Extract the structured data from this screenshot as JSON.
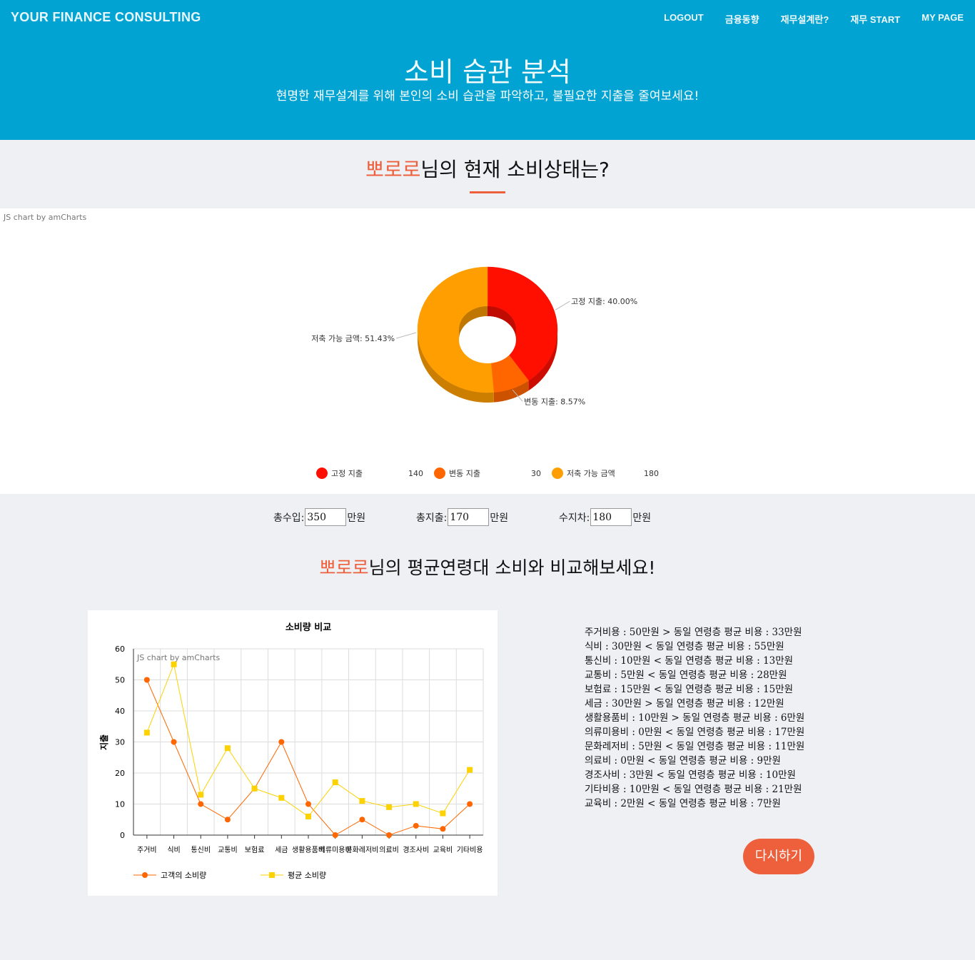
{
  "nav": {
    "brand": "YOUR FINANCE CONSULTING",
    "links": [
      "LOGOUT",
      "금융동향",
      "재무설계란?",
      "재무 START",
      "MY PAGE"
    ]
  },
  "hero": {
    "title": "소비 습관 분석",
    "subtitle": "현명한 재무설계를 위해 본인의 소비 습관을 파악하고, 불필요한 지출을 줄여보세요!"
  },
  "section1": {
    "user": "뽀로로",
    "title_rest": "님의 현재 소비상태는?"
  },
  "credit": "JS chart by amCharts",
  "colors": {
    "accent": "#ee5f3b",
    "header": "#00a3d1"
  },
  "chart_data": [
    {
      "type": "pie",
      "style": "3d-donut",
      "slices": [
        {
          "name": "고정 지출",
          "value": 140,
          "percent_label": "40.00%",
          "color": "#ff0f00"
        },
        {
          "name": "변동 지출",
          "value": 30,
          "percent_label": "8.57%",
          "color": "#ff6600"
        },
        {
          "name": "저축 가능 금액",
          "value": 180,
          "percent_label": "51.43%",
          "color": "#ff9e01"
        }
      ],
      "legend_position": "bottom"
    },
    {
      "type": "line",
      "title": "소비량 비교",
      "ylabel": "지출",
      "xlabel": "",
      "ylim": [
        0,
        60
      ],
      "yticks": [
        0,
        10,
        20,
        30,
        40,
        50,
        60
      ],
      "grid": true,
      "legend_position": "bottom",
      "categories": [
        "주거비",
        "식비",
        "통신비",
        "교통비",
        "보험료",
        "세금",
        "생활용품비",
        "의류미용비",
        "문화레저비",
        "의료비",
        "경조사비",
        "교육비",
        "기타비용"
      ],
      "series": [
        {
          "name": "고객의 소비량",
          "color": "#ff6600",
          "marker": "circle",
          "values": [
            50,
            30,
            10,
            5,
            15,
            30,
            10,
            0,
            5,
            0,
            3,
            2,
            10
          ]
        },
        {
          "name": "평균 소비량",
          "color": "#fcd202",
          "marker": "square",
          "values": [
            33,
            55,
            13,
            28,
            15,
            12,
            6,
            17,
            11,
            9,
            10,
            7,
            21
          ]
        }
      ]
    }
  ],
  "summary": {
    "income_label": "총수입:",
    "income_value": "350",
    "expense_label": "총지출:",
    "expense_value": "170",
    "balance_label": "수지차:",
    "balance_value": "180",
    "unit": "만원"
  },
  "section2": {
    "user": "뽀로로",
    "title_rest": "님의 평균연령대 소비와 비교해보세요!"
  },
  "compare_lines": [
    "주거비용 : 50만원 > 동일 연령층 평균 비용 : 33만원",
    "식비 : 30만원 < 동일 연령층 평균 비용 : 55만원",
    "통신비 : 10만원 < 동일 연령층 평균 비용 : 13만원",
    "교통비 : 5만원 < 동일 연령층 평균 비용 : 28만원",
    "보험료 : 15만원 < 동일 연령층 평균 비용 : 15만원",
    "세금 : 30만원 > 동일 연령층 평균 비용 : 12만원",
    "생활용품비 : 10만원 > 동일 연령층 평균 비용 : 6만원",
    "의류미용비 : 0만원 < 동일 연령층 평균 비용 : 17만원",
    "문화레저비 : 5만원 < 동일 연령층 평균 비용 : 11만원",
    "의료비 : 0만원 < 동일 연령층 평균 비용 : 9만원",
    "경조사비 : 3만원 < 동일 연령층 평균 비용 : 10만원",
    "기타비용 : 10만원 < 동일 연령층 평균 비용 : 21만원",
    "교육비 : 2만원 < 동일 연령층 평균 비용 : 7만원"
  ],
  "retry_label": "다시하기"
}
